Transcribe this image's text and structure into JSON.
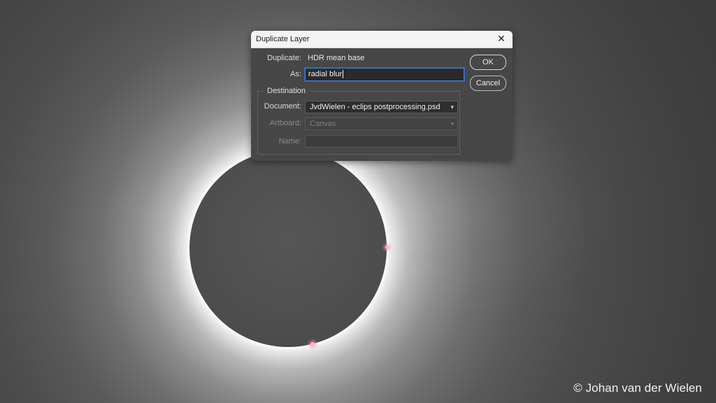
{
  "dialog": {
    "title": "Duplicate Layer",
    "close_icon": "close-icon",
    "duplicate_label": "Duplicate:",
    "duplicate_value": "HDR mean base",
    "as_label": "As:",
    "as_value": "radial blur",
    "ok_label": "OK",
    "cancel_label": "Cancel",
    "destination": {
      "title": "Destination",
      "document_label": "Document:",
      "document_value": "JvdWielen - eclips postprocessing.psd",
      "artboard_label": "Artboard:",
      "artboard_value": "Canvas",
      "name_label": "Name:",
      "name_value": ""
    }
  },
  "background": {
    "copyright": "© Johan van der Wielen"
  },
  "colors": {
    "dialog_bg": "#474747",
    "titlebar_bg": "#f3f3f3",
    "focus_accent": "#4a7fd6"
  }
}
